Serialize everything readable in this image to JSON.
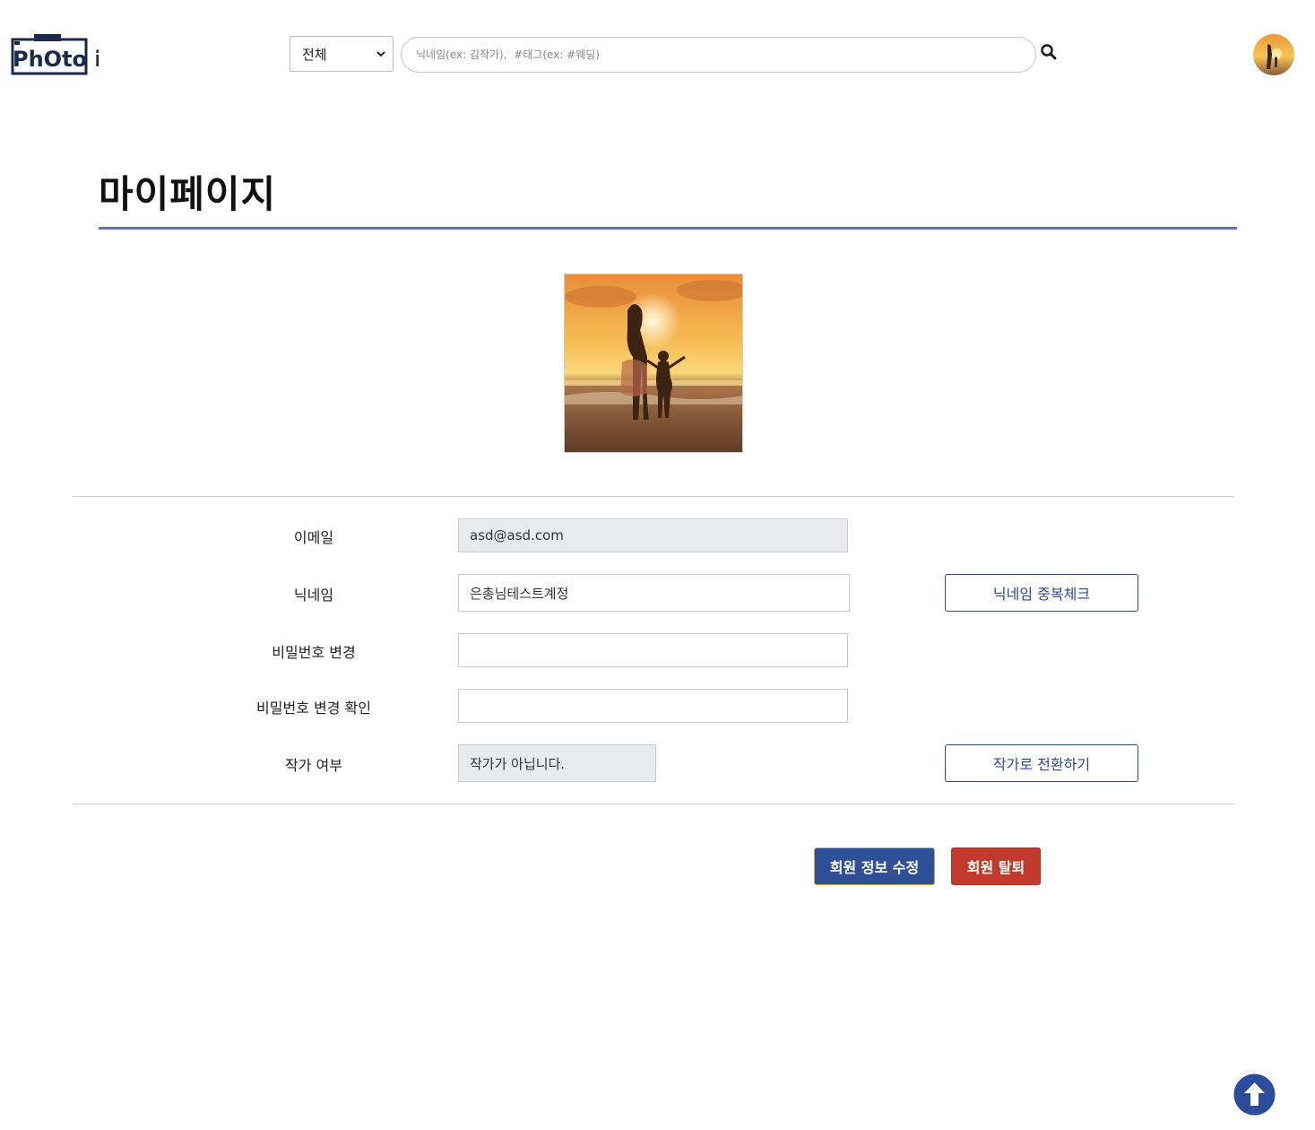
{
  "header": {
    "logo_text": "PhOto it",
    "category_select": {
      "selected": "전체"
    },
    "search": {
      "placeholder": "닉네임(ex: 김작가),  #태그(ex: #웨딩)",
      "value": ""
    }
  },
  "page": {
    "title": "마이페이지"
  },
  "form": {
    "email": {
      "label": "이메일",
      "value": "asd@asd.com"
    },
    "nickname": {
      "label": "닉네임",
      "value": "은총님테스트계정",
      "check_button": "닉네임 중복체크"
    },
    "password": {
      "label": "비밀번호 변경",
      "value": ""
    },
    "password_confirm": {
      "label": "비밀번호 변경 확인",
      "value": ""
    },
    "artist": {
      "label": "작가 여부",
      "value": "작가가 아닙니다.",
      "convert_button": "작가로 전환하기"
    }
  },
  "actions": {
    "edit_label": "회원 정보 수정",
    "withdraw_label": "회원 탈퇴"
  },
  "colors": {
    "accent_blue": "#2f4f99",
    "danger_red": "#c23a2c",
    "title_rule": "#6575a3",
    "outline_blue": "#2e4a8f"
  },
  "icons": {
    "search": "search-icon",
    "select_chevron": "chevron-down-icon",
    "scroll_top": "arrow-up-circle-icon"
  }
}
